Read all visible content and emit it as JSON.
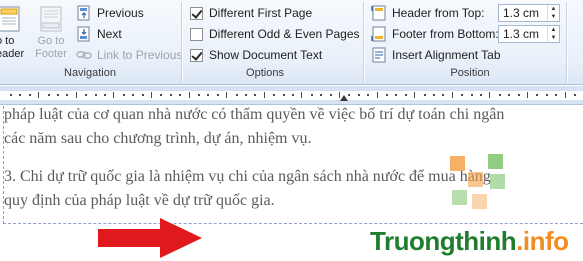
{
  "ribbon": {
    "navigation": {
      "label": "Navigation",
      "goto_header": "o to\neader",
      "goto_footer": "Go to\nFooter",
      "previous": "Previous",
      "next": "Next",
      "link_to_previous": "Link to Previous"
    },
    "options": {
      "label": "Options",
      "different_first_page": {
        "label": "Different First Page",
        "checked": true
      },
      "different_odd_even": {
        "label": "Different Odd & Even Pages",
        "checked": false
      },
      "show_document_text": {
        "label": "Show Document Text",
        "checked": true
      }
    },
    "position": {
      "label": "Position",
      "header_from_top": {
        "label": "Header from Top:",
        "value": "1.3 cm"
      },
      "footer_from_bottom": {
        "label": "Footer from Bottom:",
        "value": "1.3 cm"
      },
      "insert_alignment_tab": "Insert Alignment Tab"
    }
  },
  "document": {
    "lines": [
      "pháp luật của cơ quan nhà nước có thẩm quyền về việc bố trí dự toán chi ngân",
      "các năm sau cho chương trình, dự án, nhiệm vụ.",
      "",
      "3. Chi dự trữ quốc gia là nhiệm vụ chi của ngân sách nhà nước để mua hàng",
      "quy định của pháp luật về dự trữ quốc gia."
    ]
  },
  "watermark": {
    "brand_part1": "Truongthinh",
    "brand_part2": ".info",
    "colors": {
      "green": "#1e7e2d",
      "orange": "#f28c1e",
      "arrow_red": "#e0191c"
    }
  }
}
